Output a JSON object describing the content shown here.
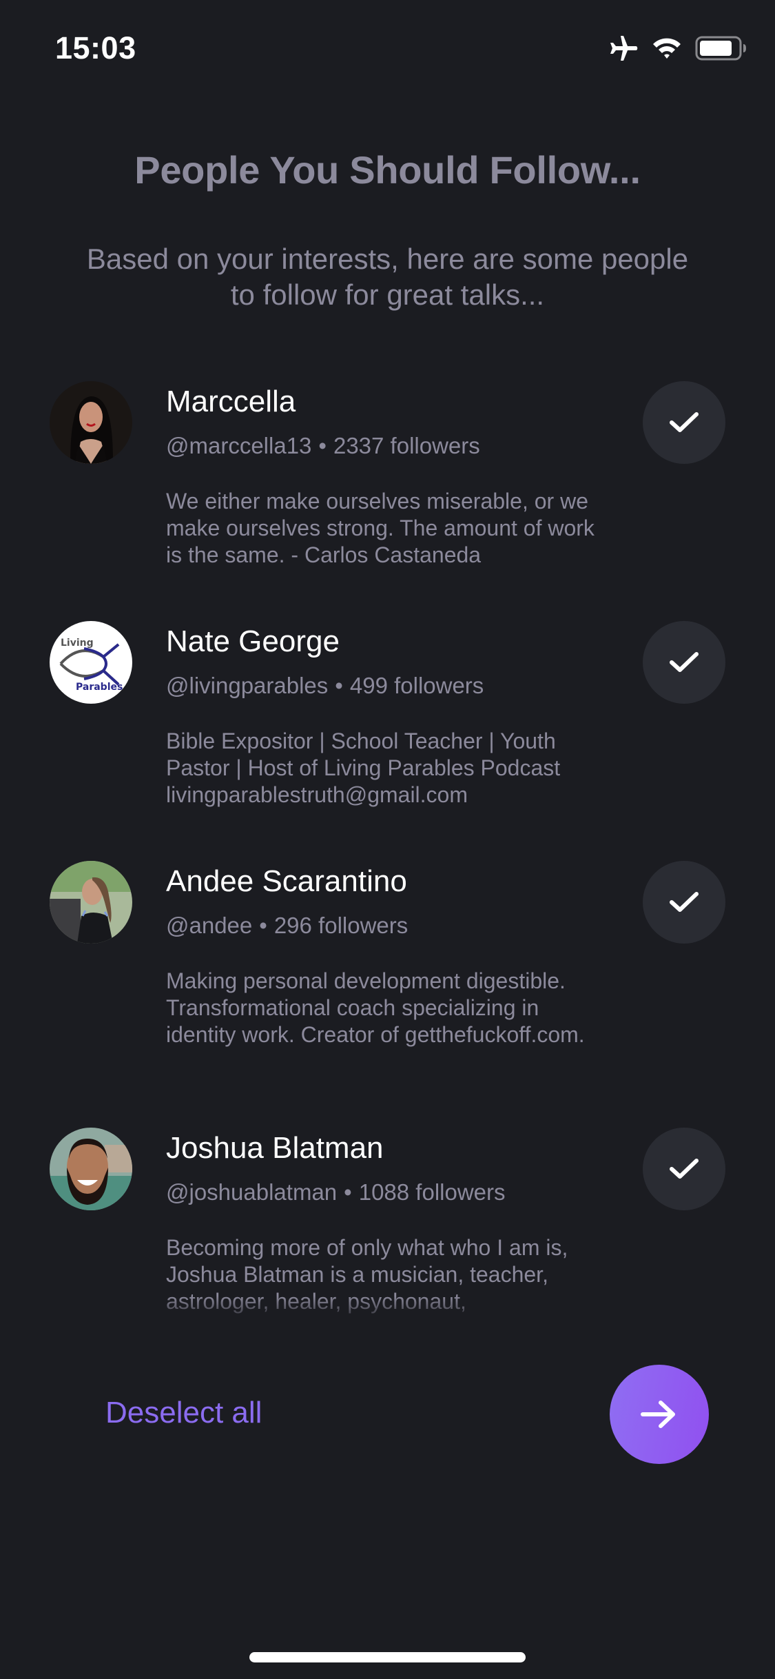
{
  "status_bar": {
    "time": "15:03",
    "icons": [
      "airplane-mode-icon",
      "wifi-icon",
      "battery-icon"
    ]
  },
  "header": {
    "title": "People You Should Follow...",
    "subtitle": "Based on your interests, here are some people to follow for great talks..."
  },
  "people": [
    {
      "name": "Marccella",
      "handle": "@marccella13",
      "separator": "•",
      "followers": "2337 followers",
      "bio": "We either make ourselves miserable, or we make ourselves strong. The amount of work is the same. - Carlos Castaneda",
      "selected": true
    },
    {
      "name": "Nate George",
      "handle": "@livingparables",
      "separator": "•",
      "followers": "499 followers",
      "bio": "Bible Expositor | School Teacher | Youth Pastor | Host of Living Parables Podcast livingparablestruth@gmail.com",
      "avatar_text": [
        "Living",
        "Parables"
      ],
      "selected": true
    },
    {
      "name": "Andee Scarantino",
      "handle": "@andee",
      "separator": "•",
      "followers": "296 followers",
      "bio": "Making personal development digestible. Transformational coach specializing in identity work. Creator of getthefuckoff.com.",
      "selected": true
    },
    {
      "name": "Joshua Blatman",
      "handle": "@joshuablatman",
      "separator": "•",
      "followers": "1088 followers",
      "bio": "Becoming more of only what who I am is, Joshua Blatman is a musician, teacher, astrologer, healer, psychonaut,",
      "selected": true
    }
  ],
  "footer": {
    "deselect_label": "Deselect all",
    "next_icon": "arrow-right-icon"
  },
  "colors": {
    "background": "#1b1c21",
    "muted_text": "#8c8a9c",
    "accent": "#8b6cf0",
    "check_bg": "#2a2c33"
  }
}
